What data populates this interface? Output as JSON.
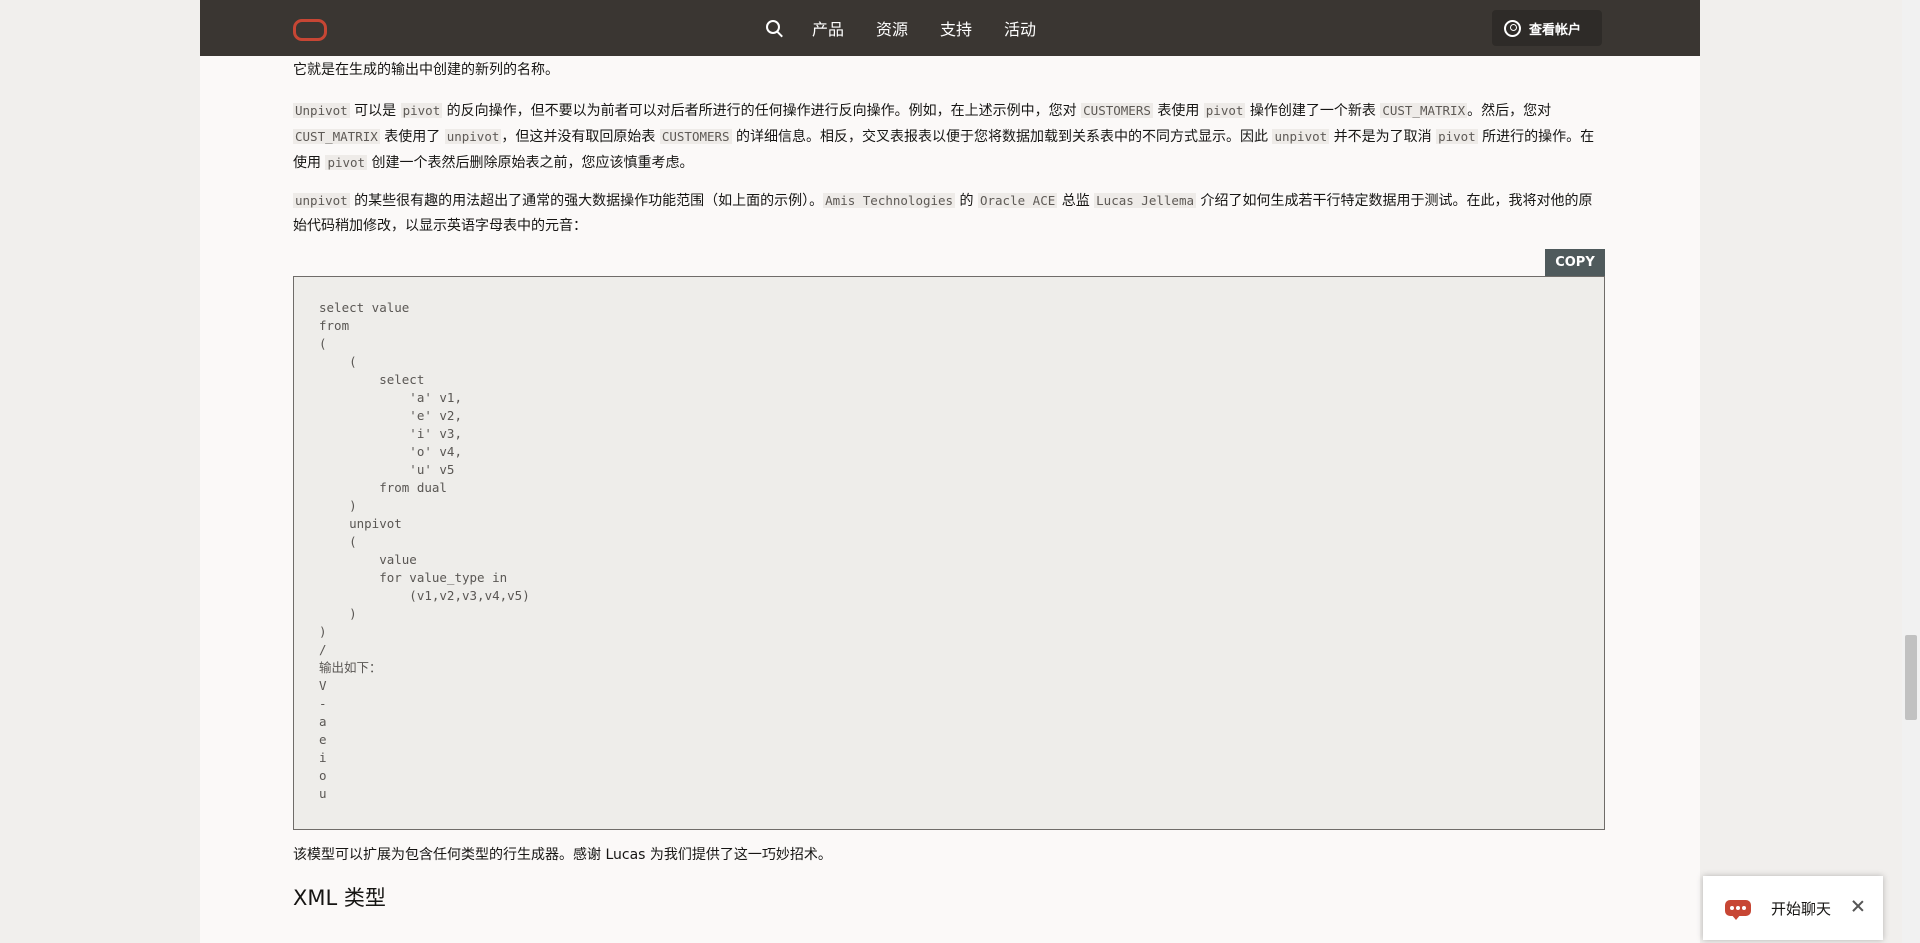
{
  "header": {
    "nav": [
      "产品",
      "资源",
      "支持",
      "活动"
    ],
    "account_label": "查看帐户"
  },
  "paragraphs": [
    [
      {
        "t": "它就是在生成的输出中创建的新列的名称。"
      }
    ],
    [
      {
        "c": "Unpivot"
      },
      {
        "t": " 可以是 "
      },
      {
        "c": "pivot"
      },
      {
        "t": " 的反向操作，但不要以为前者可以对后者所进行的任何操作进行反向操作。例如，在上述示例中，您对 "
      },
      {
        "c": "CUSTOMERS"
      },
      {
        "t": " 表使用 "
      },
      {
        "c": "pivot"
      },
      {
        "t": " 操作创建了一个新表 "
      },
      {
        "c": "CUST_MATRIX"
      },
      {
        "t": "。然后，您对 "
      },
      {
        "c": "CUST_MATRIX"
      },
      {
        "t": " 表使用了 "
      },
      {
        "c": "unpivot"
      },
      {
        "t": "，但这并没有取回原始表 "
      },
      {
        "c": "CUSTOMERS"
      },
      {
        "t": " 的详细信息。相反，交叉表报表以便于您将数据加载到关系表中的不同方式显示。因此 "
      },
      {
        "c": "unpivot"
      },
      {
        "t": " 并不是为了取消 "
      },
      {
        "c": "pivot"
      },
      {
        "t": " 所进行的操作。在使用 "
      },
      {
        "c": "pivot"
      },
      {
        "t": " 创建一个表然后删除原始表之前，您应该慎重考虑。"
      }
    ],
    [
      {
        "c": "unpivot"
      },
      {
        "t": " 的某些很有趣的用法超出了通常的强大数据操作功能范围（如上面的示例）。"
      },
      {
        "c": "Amis Technologies"
      },
      {
        "t": " 的 "
      },
      {
        "c": "Oracle ACE"
      },
      {
        "t": " 总监 "
      },
      {
        "c": "Lucas Jellema"
      },
      {
        "t": " 介绍了如何生成若干行特定数据用于测试。在此，我将对他的原始代码稍加修改，以显示英语字母表中的元音："
      }
    ]
  ],
  "copy_label": "COPY",
  "code": "select value\nfrom\n(\n    (\n        select\n            'a' v1,\n            'e' v2,\n            'i' v3,\n            'o' v4,\n            'u' v5\n        from dual\n    )\n    unpivot\n    (\n        value\n        for value_type in\n            (v1,v2,v3,v4,v5)\n    )\n)\n/\n输出如下：\nV\n-\na\ne\ni\no\nu",
  "after_text": "该模型可以扩展为包含任何类型的行生成器。感谢 Lucas 为我们提供了这一巧妙招术。",
  "section_heading": "XML 类型",
  "chat": {
    "label": "开始聊天"
  }
}
